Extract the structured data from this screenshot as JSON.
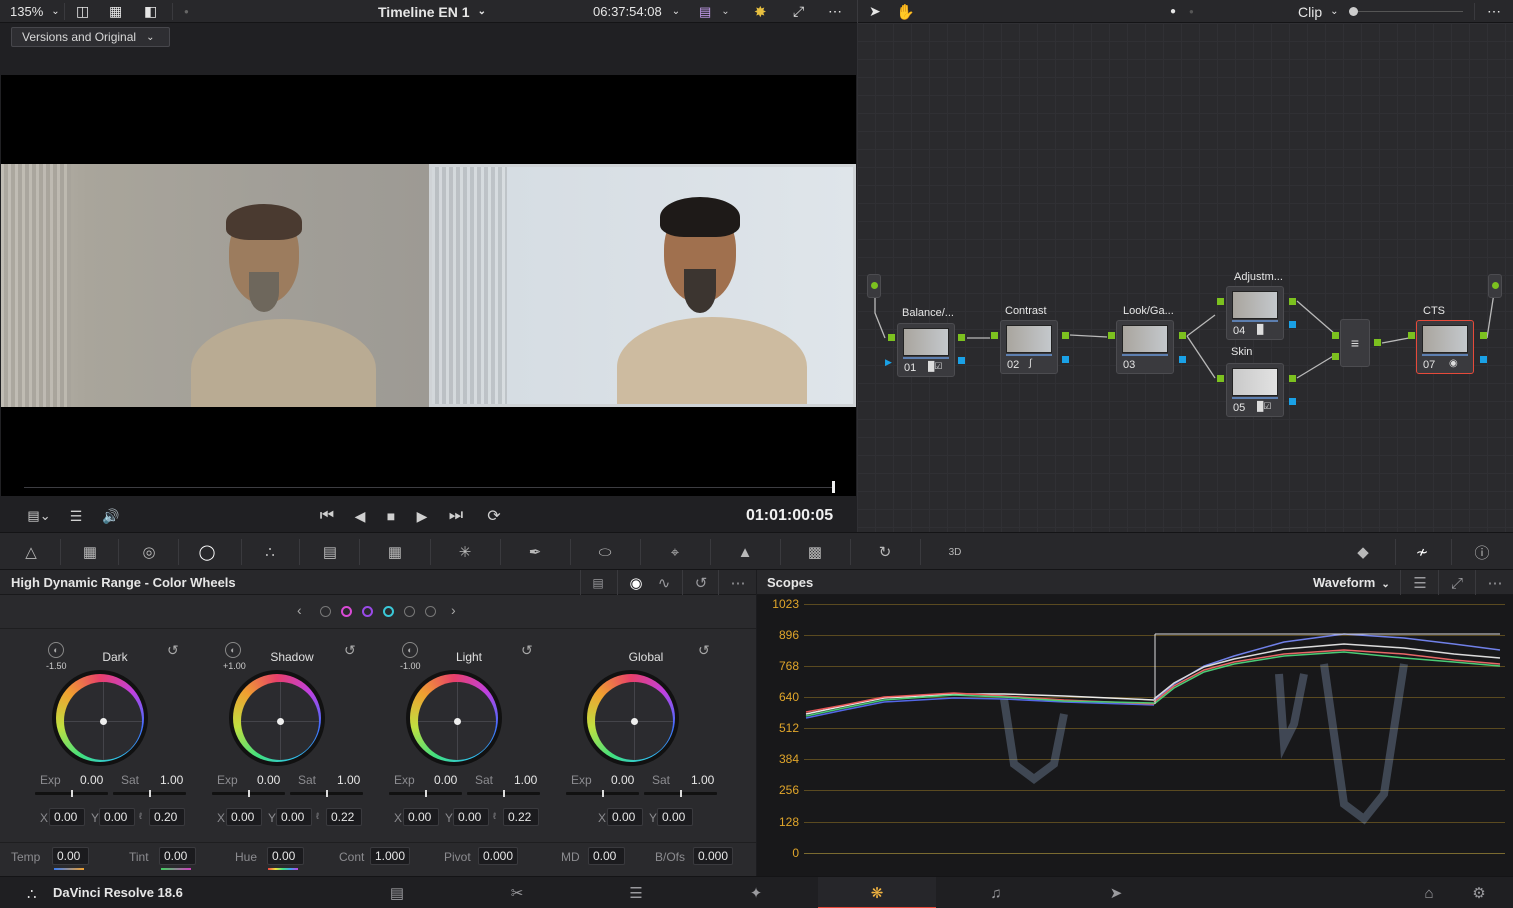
{
  "topbar": {
    "zoom": "135%",
    "timeline_title": "Timeline EN 1",
    "timecode": "06:37:54:08",
    "node_mode": "Clip"
  },
  "viewer": {
    "compare_mode": "Versions and Original",
    "playhead_timecode": "01:01:00:05"
  },
  "nodes": [
    {
      "label": "Balance/...",
      "num": "01"
    },
    {
      "label": "Contrast",
      "num": "02"
    },
    {
      "label": "Look/Ga...",
      "num": "03"
    },
    {
      "label": "Adjustm...",
      "num": "04"
    },
    {
      "label": "Skin",
      "num": "05"
    },
    {
      "label": "CTS",
      "num": "07"
    }
  ],
  "panel": {
    "title": "High Dynamic Range - Color Wheels"
  },
  "wheels": [
    {
      "name": "Dark",
      "offset": "-1.50",
      "exp": "0.00",
      "sat": "1.00",
      "x": "0.00",
      "y": "0.00",
      "z": "0.20"
    },
    {
      "name": "Shadow",
      "offset": "+1.00",
      "exp": "0.00",
      "sat": "1.00",
      "x": "0.00",
      "y": "0.00",
      "z": "0.22"
    },
    {
      "name": "Light",
      "offset": "-1.00",
      "exp": "0.00",
      "sat": "1.00",
      "x": "0.00",
      "y": "0.00",
      "z": "0.22"
    },
    {
      "name": "Global",
      "offset": "",
      "exp": "0.00",
      "sat": "1.00",
      "x": "0.00",
      "y": "0.00",
      "z": ""
    }
  ],
  "labels": {
    "exp": "Exp",
    "sat": "Sat",
    "x": "X",
    "y": "Y"
  },
  "params": [
    {
      "label": "Temp",
      "value": "0.00"
    },
    {
      "label": "Tint",
      "value": "0.00"
    },
    {
      "label": "Hue",
      "value": "0.00"
    },
    {
      "label": "Cont",
      "value": "1.000"
    },
    {
      "label": "Pivot",
      "value": "0.000"
    },
    {
      "label": "MD",
      "value": "0.00"
    },
    {
      "label": "B/Ofs",
      "value": "0.000"
    }
  ],
  "scopes": {
    "title": "Scopes",
    "mode": "Waveform",
    "y_ticks": [
      "1023",
      "896",
      "768",
      "640",
      "512",
      "384",
      "256",
      "128",
      "0"
    ]
  },
  "app": {
    "name": "DaVinci Resolve 18.6"
  },
  "colors": {
    "accent": "#e64a3a",
    "green_port": "#7cc11f",
    "blue_port": "#1aa1e6",
    "scope_grid": "#e0a52a"
  }
}
